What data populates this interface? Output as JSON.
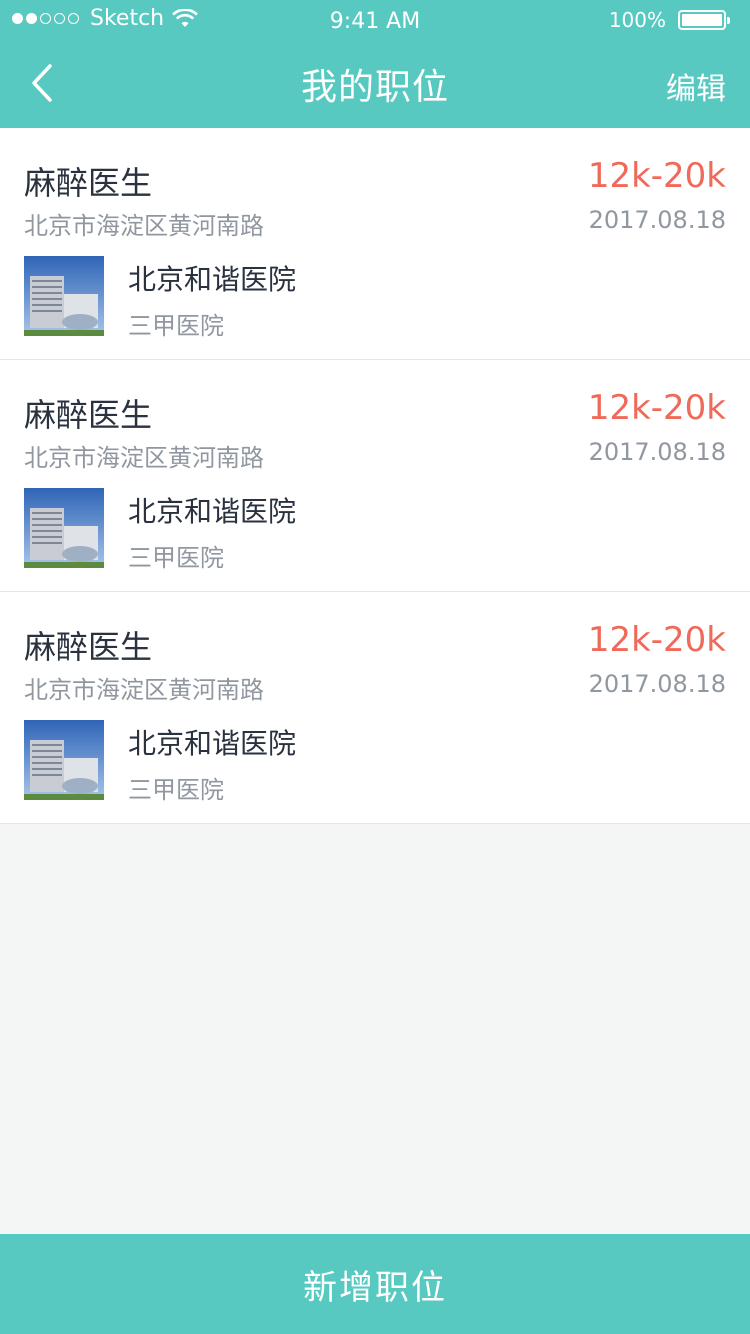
{
  "status_bar": {
    "carrier": "Sketch",
    "time": "9:41 AM",
    "battery_pct": "100%"
  },
  "nav": {
    "title": "我的职位",
    "edit_label": "编辑",
    "back_icon": "chevron-left-icon"
  },
  "jobs": [
    {
      "title": "麻醉医生",
      "salary": "12k-20k",
      "address": "北京市海淀区黄河南路",
      "date": "2017.08.18",
      "hospital_name": "北京和谐医院",
      "hospital_level": "三甲医院"
    },
    {
      "title": "麻醉医生",
      "salary": "12k-20k",
      "address": "北京市海淀区黄河南路",
      "date": "2017.08.18",
      "hospital_name": "北京和谐医院",
      "hospital_level": "三甲医院"
    },
    {
      "title": "麻醉医生",
      "salary": "12k-20k",
      "address": "北京市海淀区黄河南路",
      "date": "2017.08.18",
      "hospital_name": "北京和谐医院",
      "hospital_level": "三甲医院"
    }
  ],
  "add_button_label": "新增职位",
  "colors": {
    "accent": "#57c9c1",
    "salary": "#f06a5a",
    "primary_text": "#2a3240",
    "secondary_text": "#9097a0",
    "background": "#f4f5f5"
  }
}
